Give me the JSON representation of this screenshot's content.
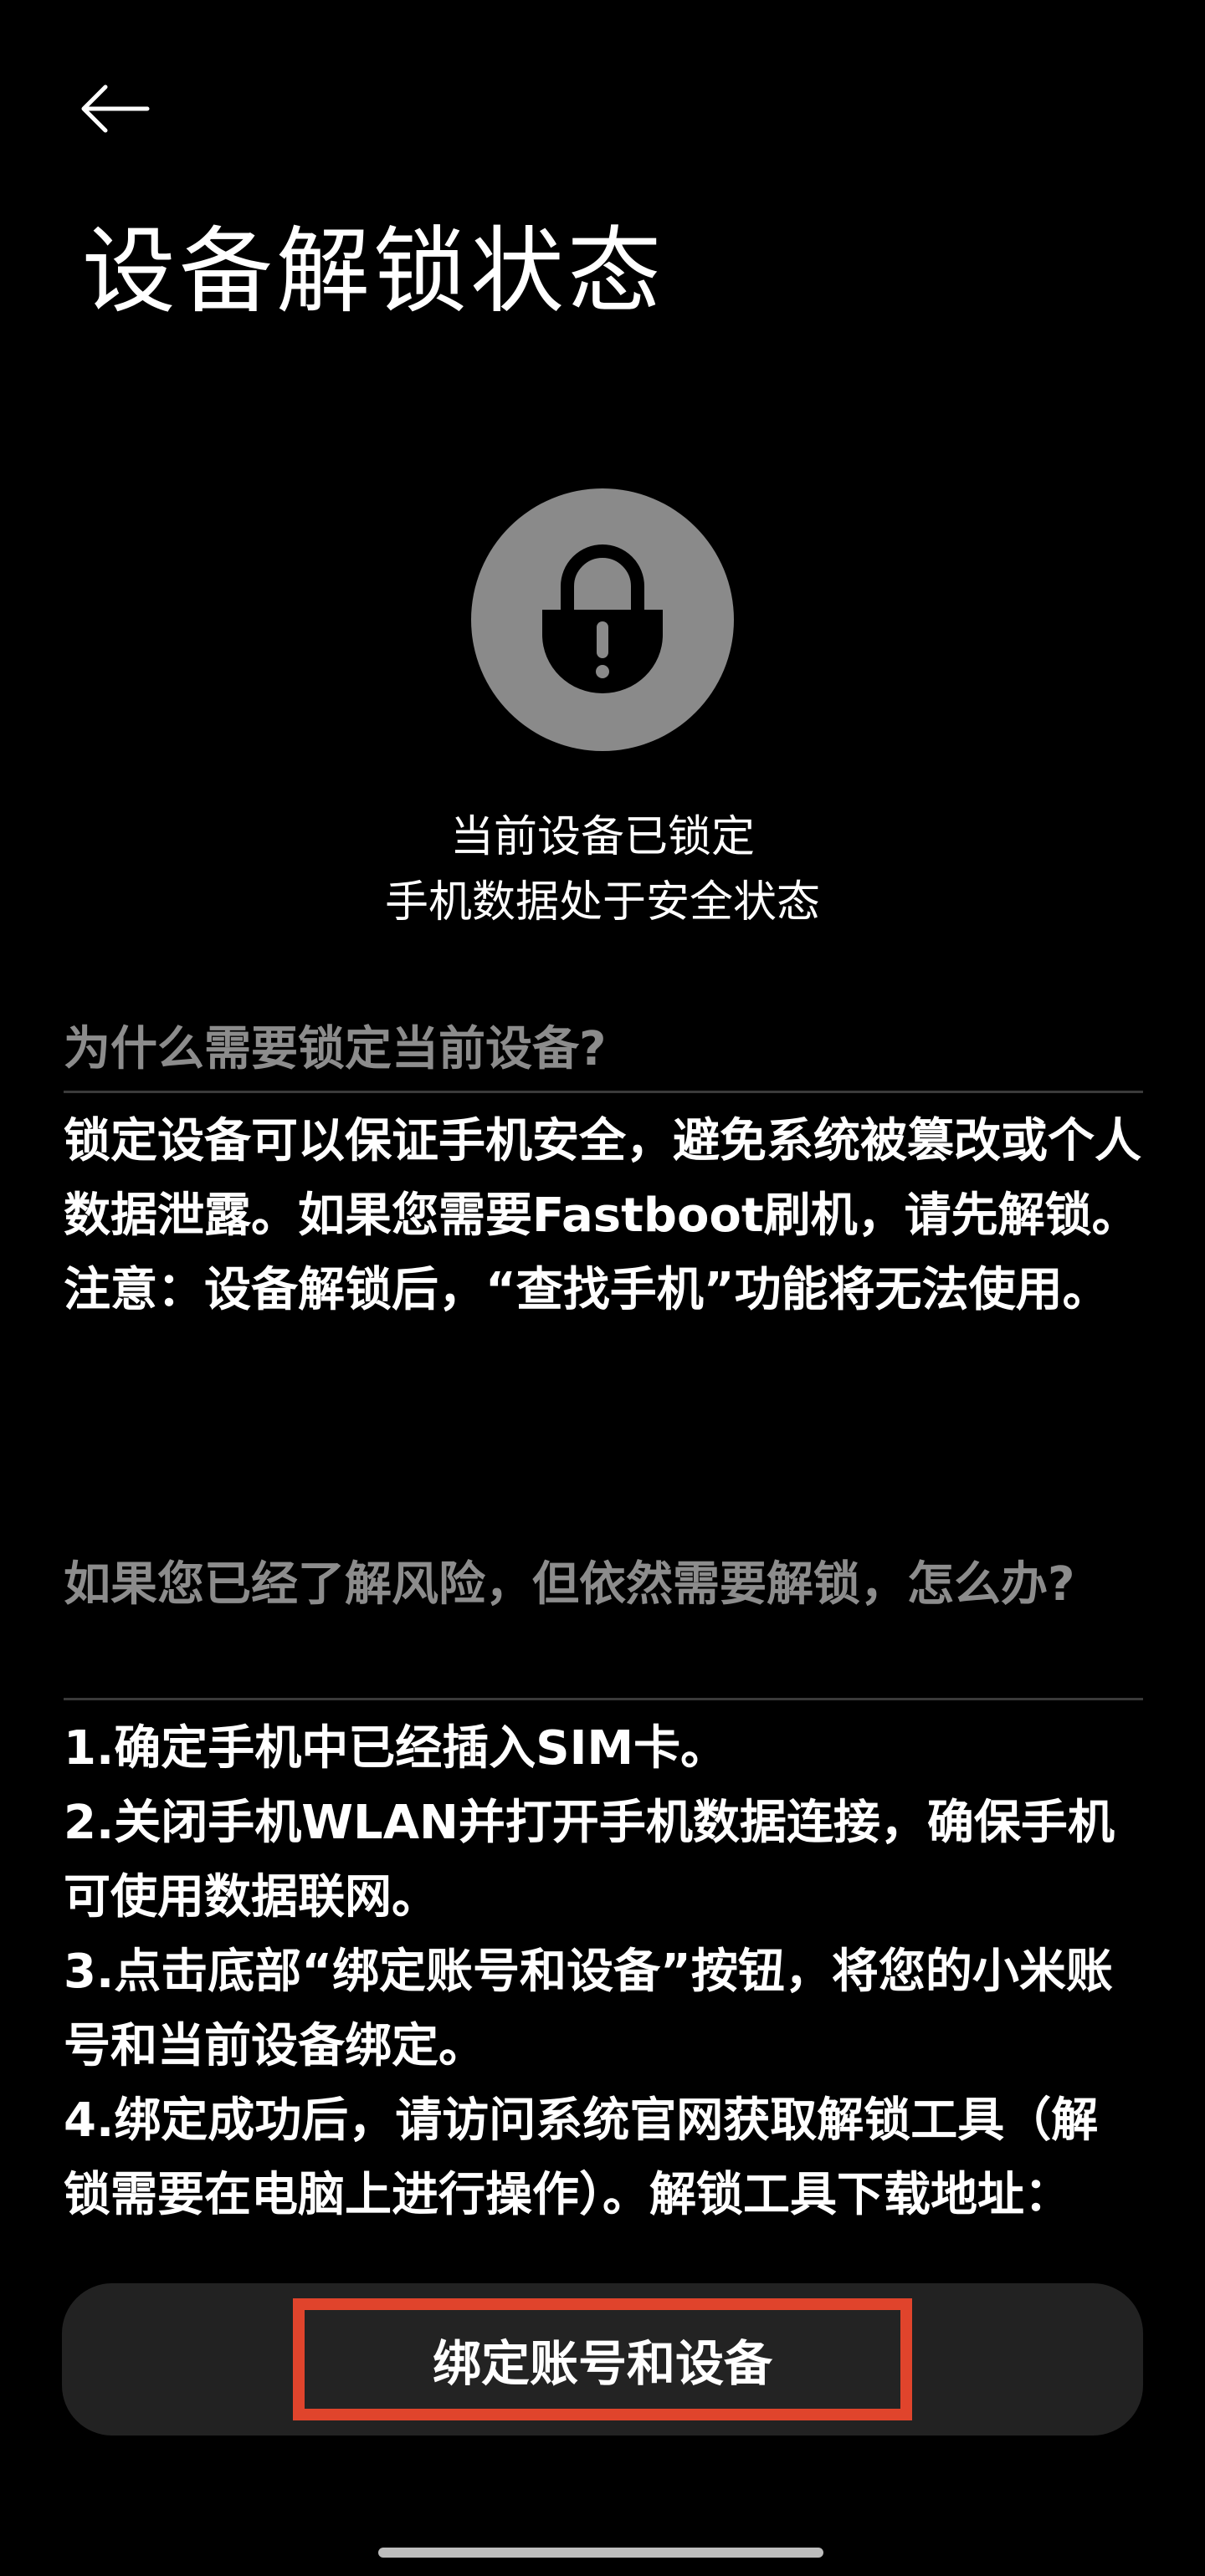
{
  "header": {
    "back_icon": "arrow-left-icon",
    "title": "设备解锁状态"
  },
  "status": {
    "icon": "lock-warning-icon",
    "icon_bg_color": "#8a8a8a",
    "line1": "当前设备已锁定",
    "line2": "手机数据处于安全状态"
  },
  "section1": {
    "heading": "为什么需要锁定当前设备?",
    "paragraphs": [
      "锁定设备可以保证手机安全，避免系统被篡改或个人数据泄露。如果您需要Fastboot刷机，请先解锁。",
      "注意：设备解锁后，“查找手机”功能将无法使用。"
    ]
  },
  "section2": {
    "heading": "如果您已经了解风险，但依然需要解锁，怎么办?",
    "steps": [
      "1.确定手机中已经插入SIM卡。",
      "2.关闭手机WLAN并打开手机数据连接，确保手机可使用数据联网。",
      "3.点击底部“绑定账号和设备”按钮，将您的小米账号和当前设备绑定。",
      "4.绑定成功后，请访问系统官网获取解锁工具（解锁需要在电脑上进行操作）。解锁工具下载地址："
    ]
  },
  "bottom": {
    "bind_button_label": "绑定账号和设备",
    "highlight_color": "#e0442c"
  }
}
